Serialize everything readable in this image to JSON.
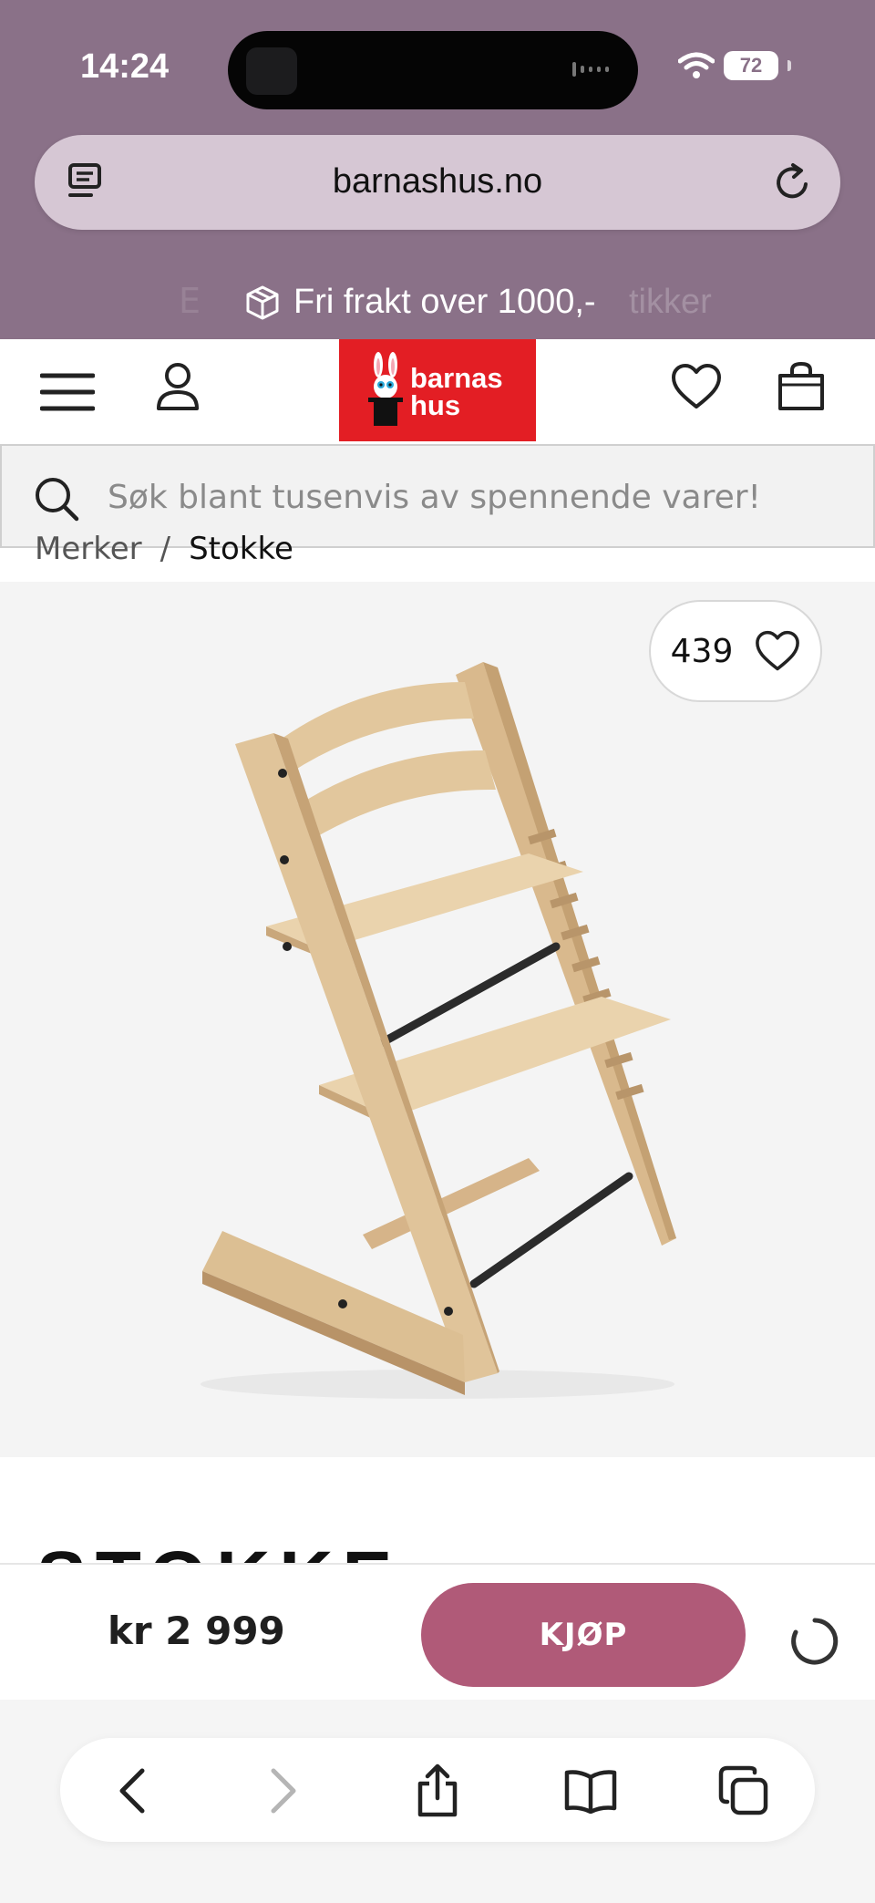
{
  "status_bar": {
    "time": "14:24",
    "battery": "72"
  },
  "browser": {
    "url": "barnashus.no"
  },
  "promo": {
    "text": "Fri frakt over 1000,-",
    "ghost_left": "E",
    "ghost_right": "tikker"
  },
  "header": {
    "logo_line1": "barnas",
    "logo_line2": "hus"
  },
  "search": {
    "placeholder": "Søk blant tusenvis av spennende varer!"
  },
  "breadcrumb": {
    "items": [
      "Merker",
      "Stokke"
    ],
    "separator": "/"
  },
  "product": {
    "wishlist_count": "439",
    "brand": "STOKKE"
  },
  "buy_bar": {
    "price": "kr 2 999",
    "buy_label": "KJØP"
  },
  "colors": {
    "browser_purple": "#8a7188",
    "buy_button": "#b05a78",
    "logo_red": "#e31e24"
  },
  "icons": [
    "tabs-icon",
    "reload-icon",
    "box-icon",
    "menu-icon",
    "user-icon",
    "heart-icon",
    "bag-icon",
    "search-icon",
    "spinner-icon",
    "back-icon",
    "forward-icon",
    "share-icon",
    "bookmarks-icon",
    "tabs-overview-icon"
  ]
}
